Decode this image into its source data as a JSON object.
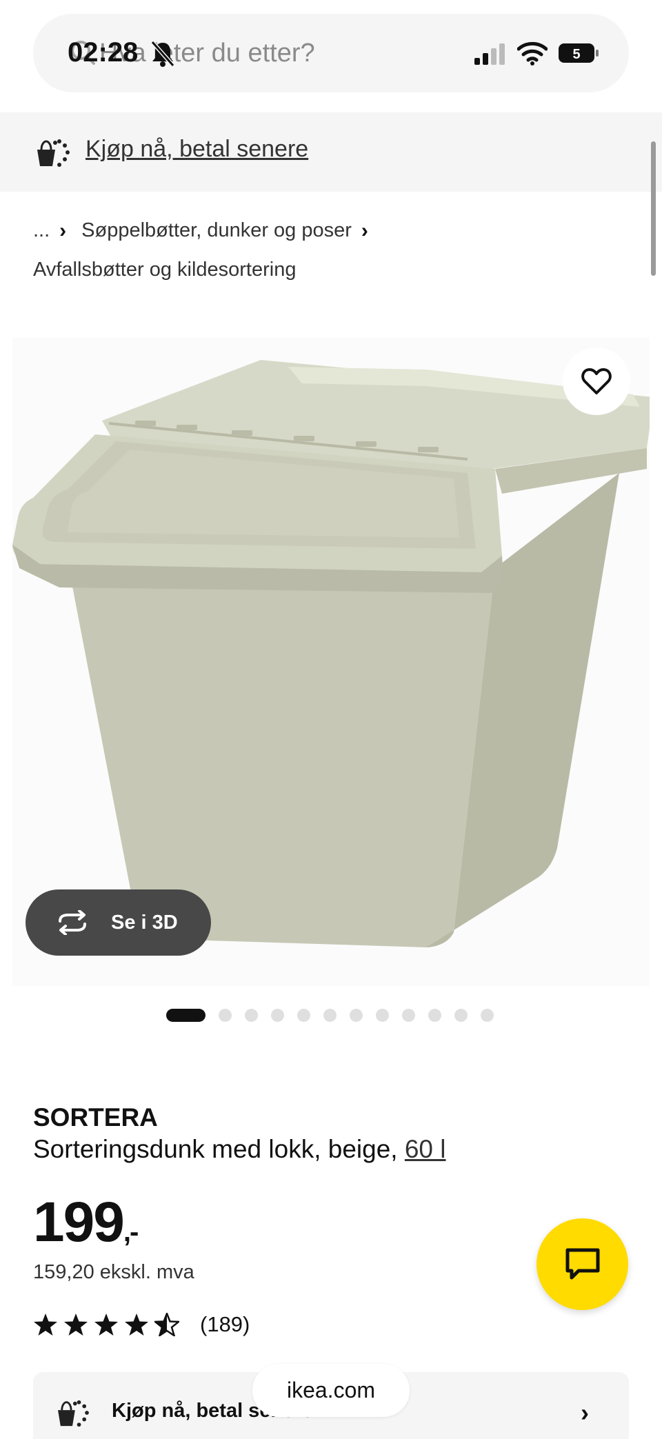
{
  "status_bar": {
    "time": "02:28"
  },
  "search": {
    "placeholder": "Hva leter du etter?"
  },
  "paylater_banner": {
    "label": "Kjøp nå, betal senere"
  },
  "breadcrumb": {
    "ellipsis": "...",
    "category": "Søppelbøtter, dunker og poser",
    "current": "Avfallsbøtter og kildesortering"
  },
  "gallery": {
    "view_3d_label": "Se i 3D",
    "image_count": 13,
    "active_index": 0
  },
  "product": {
    "brand": "SORTERA",
    "description": "Sorteringsdunk med lokk, beige,",
    "size": "60 l",
    "price": "199",
    "price_suffix": ",-",
    "price_ex_vat": "159,20 ekskl. mva",
    "rating_value": 4.5,
    "rating_count": "(189)"
  },
  "paylater_card": {
    "label": "Kjøp nå, betal senere"
  },
  "browser": {
    "url": "ikea.com"
  },
  "colors": {
    "accent": "#ffdb00",
    "dark": "#111111",
    "pill": "#484848",
    "product": "#c9cbb8"
  }
}
